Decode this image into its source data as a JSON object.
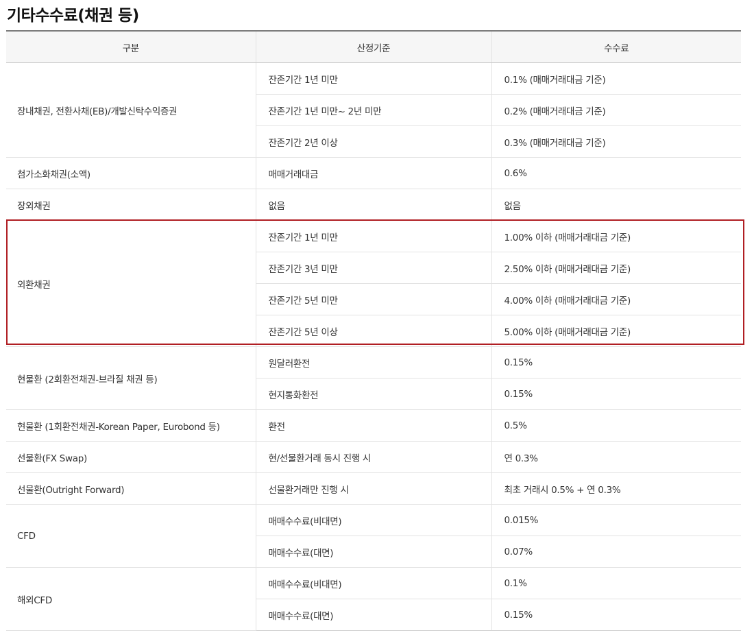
{
  "title": "기타수수료(채권 등)",
  "table": {
    "headers": [
      "구분",
      "산정기준",
      "수수료"
    ],
    "groups": [
      {
        "category": "장내채권, 전환사채(EB)/개발신탁수익증권",
        "rows": [
          {
            "basis": "잔존기간 1년 미만",
            "fee": "0.1% (매매거래대금 기준)"
          },
          {
            "basis": "잔존기간 1년 미만~ 2년 미만",
            "fee": "0.2% (매매거래대금 기준)"
          },
          {
            "basis": "잔존기간 2년 이상",
            "fee": "0.3% (매매거래대금 기준)"
          }
        ]
      },
      {
        "category": "첨가소화채권(소액)",
        "rows": [
          {
            "basis": "매매거래대금",
            "fee": "0.6%"
          }
        ]
      },
      {
        "category": "장외채권",
        "rows": [
          {
            "basis": "없음",
            "fee": "없음"
          }
        ]
      },
      {
        "category": "외환채권",
        "rows": [
          {
            "basis": "잔존기간 1년 미만",
            "fee": "1.00% 이하 (매매거래대금 기준)"
          },
          {
            "basis": "잔존기간 3년 미만",
            "fee": "2.50% 이하 (매매거래대금 기준)"
          },
          {
            "basis": "잔존기간 5년 미만",
            "fee": "4.00% 이하 (매매거래대금 기준)"
          },
          {
            "basis": "잔존기간 5년 이상",
            "fee": "5.00% 이하 (매매거래대금 기준)"
          }
        ]
      },
      {
        "category": "현물환 (2회환전채권-브라질 채권 등)",
        "rows": [
          {
            "basis": "원달러환전",
            "fee": "0.15%"
          },
          {
            "basis": "현지통화환전",
            "fee": "0.15%"
          }
        ]
      },
      {
        "category": "현물환 (1회환전채권-Korean Paper, Eurobond 등)",
        "rows": [
          {
            "basis": "환전",
            "fee": "0.5%"
          }
        ]
      },
      {
        "category": "선물환(FX Swap)",
        "rows": [
          {
            "basis": "현/선물환거래 동시 진행 시",
            "fee": "연 0.3%"
          }
        ]
      },
      {
        "category": "선물환(Outright Forward)",
        "rows": [
          {
            "basis": "선물환거래만 진행 시",
            "fee": "최초 거래시 0.5% + 연 0.3%"
          }
        ]
      },
      {
        "category": "CFD",
        "rows": [
          {
            "basis": "매매수수료(비대면)",
            "fee": "0.015%"
          },
          {
            "basis": "매매수수료(대면)",
            "fee": "0.07%"
          }
        ]
      },
      {
        "category": "해외CFD",
        "rows": [
          {
            "basis": "매매수수료(비대면)",
            "fee": "0.1%"
          },
          {
            "basis": "매매수수료(대면)",
            "fee": "0.15%"
          }
        ]
      }
    ]
  },
  "highlight_color": "#b01e23"
}
